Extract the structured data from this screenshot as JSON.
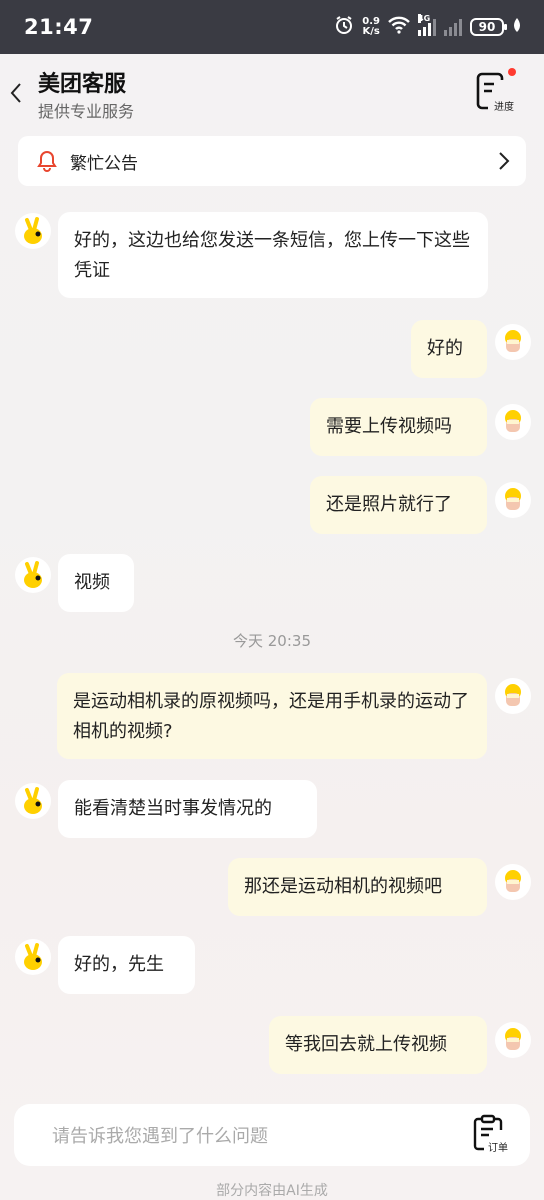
{
  "status_bar": {
    "time": "21:47",
    "net_speed_value": "0.9",
    "net_speed_unit": "K/s",
    "network_type": "4G",
    "battery": "90"
  },
  "header": {
    "title": "美团客服",
    "subtitle": "提供专业服务",
    "progress_label": "进度"
  },
  "notice": {
    "label": "繁忙公告"
  },
  "messages": [
    {
      "side": "left",
      "text": "好的，这边也给您发送一条短信，您上传一下这些凭证"
    },
    {
      "side": "right",
      "text": "好的"
    },
    {
      "side": "right",
      "text": "需要上传视频吗"
    },
    {
      "side": "right",
      "text": "还是照片就行了"
    },
    {
      "side": "left",
      "text": "视频"
    },
    {
      "side": "right",
      "text": "是运动相机录的原视频吗，还是用手机录的运动了相机的视频?"
    },
    {
      "side": "left",
      "text": "能看清楚当时事发情况的"
    },
    {
      "side": "right",
      "text": "那还是运动相机的视频吧"
    },
    {
      "side": "left",
      "text": "好的，先生"
    },
    {
      "side": "right",
      "text": "等我回去就上传视频"
    }
  ],
  "timestamp": "今天 20:35",
  "input": {
    "placeholder": "请告诉我您遇到了什么问题",
    "order_label": "订单"
  },
  "footer_note": "部分内容由AI生成",
  "colors": {
    "status_bar_bg": "#3a3b43",
    "user_bubble": "#fdf9e2",
    "agent_bubble": "#ffffff",
    "notice_icon": "#e8462f",
    "brand_yellow": "#ffd000"
  }
}
